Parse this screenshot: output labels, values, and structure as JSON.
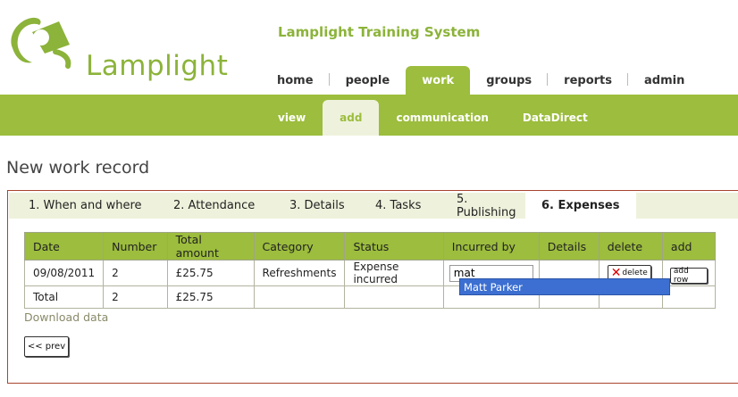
{
  "brand": {
    "logo_text": "Lamplight",
    "accent": "#9cbd3d"
  },
  "app_title": "Lamplight Training System",
  "top_nav": [
    "home",
    "people",
    "work",
    "groups",
    "reports",
    "admin"
  ],
  "top_nav_active": "work",
  "sub_nav": [
    "view",
    "add",
    "communication",
    "DataDirect"
  ],
  "sub_nav_active": "add",
  "page_title": "New work record",
  "steps": [
    "1. When and where",
    "2. Attendance",
    "3. Details",
    "4. Tasks",
    "5. Publishing",
    "6. Expenses"
  ],
  "active_step": "6. Expenses",
  "table": {
    "headers": [
      "Date",
      "Number",
      "Total amount",
      "Category",
      "Status",
      "Incurred by",
      "Details",
      "delete",
      "add"
    ],
    "row": {
      "date": "09/08/2011",
      "number": "2",
      "total_amount": "£25.75",
      "category": "Refreshments",
      "status": "Expense incurred",
      "incurred_by_value": "mat",
      "delete_label": "delete",
      "add_label": "add row"
    },
    "total_row": {
      "label": "Total",
      "number": "2",
      "total_amount": "£25.75"
    }
  },
  "autocomplete_suggestion": "Matt Parker",
  "download_link": "Download data",
  "prev_button": "<< prev"
}
